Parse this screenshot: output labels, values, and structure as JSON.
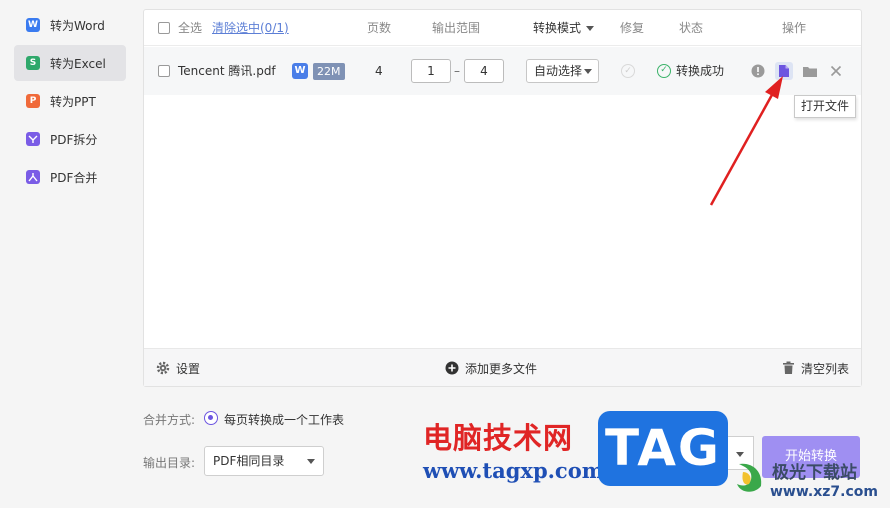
{
  "sidebar": {
    "items": [
      {
        "label": "转为Word",
        "icon": "W",
        "color": "#3a7bf0"
      },
      {
        "label": "转为Excel",
        "icon": "S",
        "color": "#2fa86b",
        "active": true
      },
      {
        "label": "转为PPT",
        "icon": "P",
        "color": "#f06a3a"
      },
      {
        "label": "PDF拆分",
        "icon": "split",
        "color": "#7a5ce6"
      },
      {
        "label": "PDF合并",
        "icon": "merge",
        "color": "#7a5ce6"
      }
    ]
  },
  "table": {
    "headers": {
      "select_all": "全选",
      "clear_selected": "清除选中(0/1)",
      "pages": "页数",
      "range": "输出范围",
      "mode": "转换模式",
      "repair": "修复",
      "status": "状态",
      "operations": "操作"
    },
    "row": {
      "filename": "Tencent 腾讯.pdf",
      "type_badge": "W",
      "size": "22M",
      "pages": "4",
      "range_from": "1",
      "range_dash": "–",
      "range_to": "4",
      "mode": "自动选择",
      "status": "转换成功"
    },
    "tooltip": "打开文件",
    "footer": {
      "settings": "设置",
      "add_more": "添加更多文件",
      "clear_list": "清空列表"
    }
  },
  "bottom": {
    "merge_label": "合并方式:",
    "merge_option": "每页转换成一个工作表",
    "output_label": "输出目录:",
    "output_value": "PDF相同目录",
    "start_button": "开始转换"
  },
  "watermark": {
    "site_cn": "电脑技术网",
    "site_url": "www.tagxp.com",
    "tag": "TAG",
    "jiguang": "极光下载站",
    "xz7": "www.xz7.com"
  },
  "colors": {
    "accent": "#6c55e0",
    "button": "#9f8ff2",
    "success": "#3bb36a",
    "arrow": "#e02020"
  }
}
